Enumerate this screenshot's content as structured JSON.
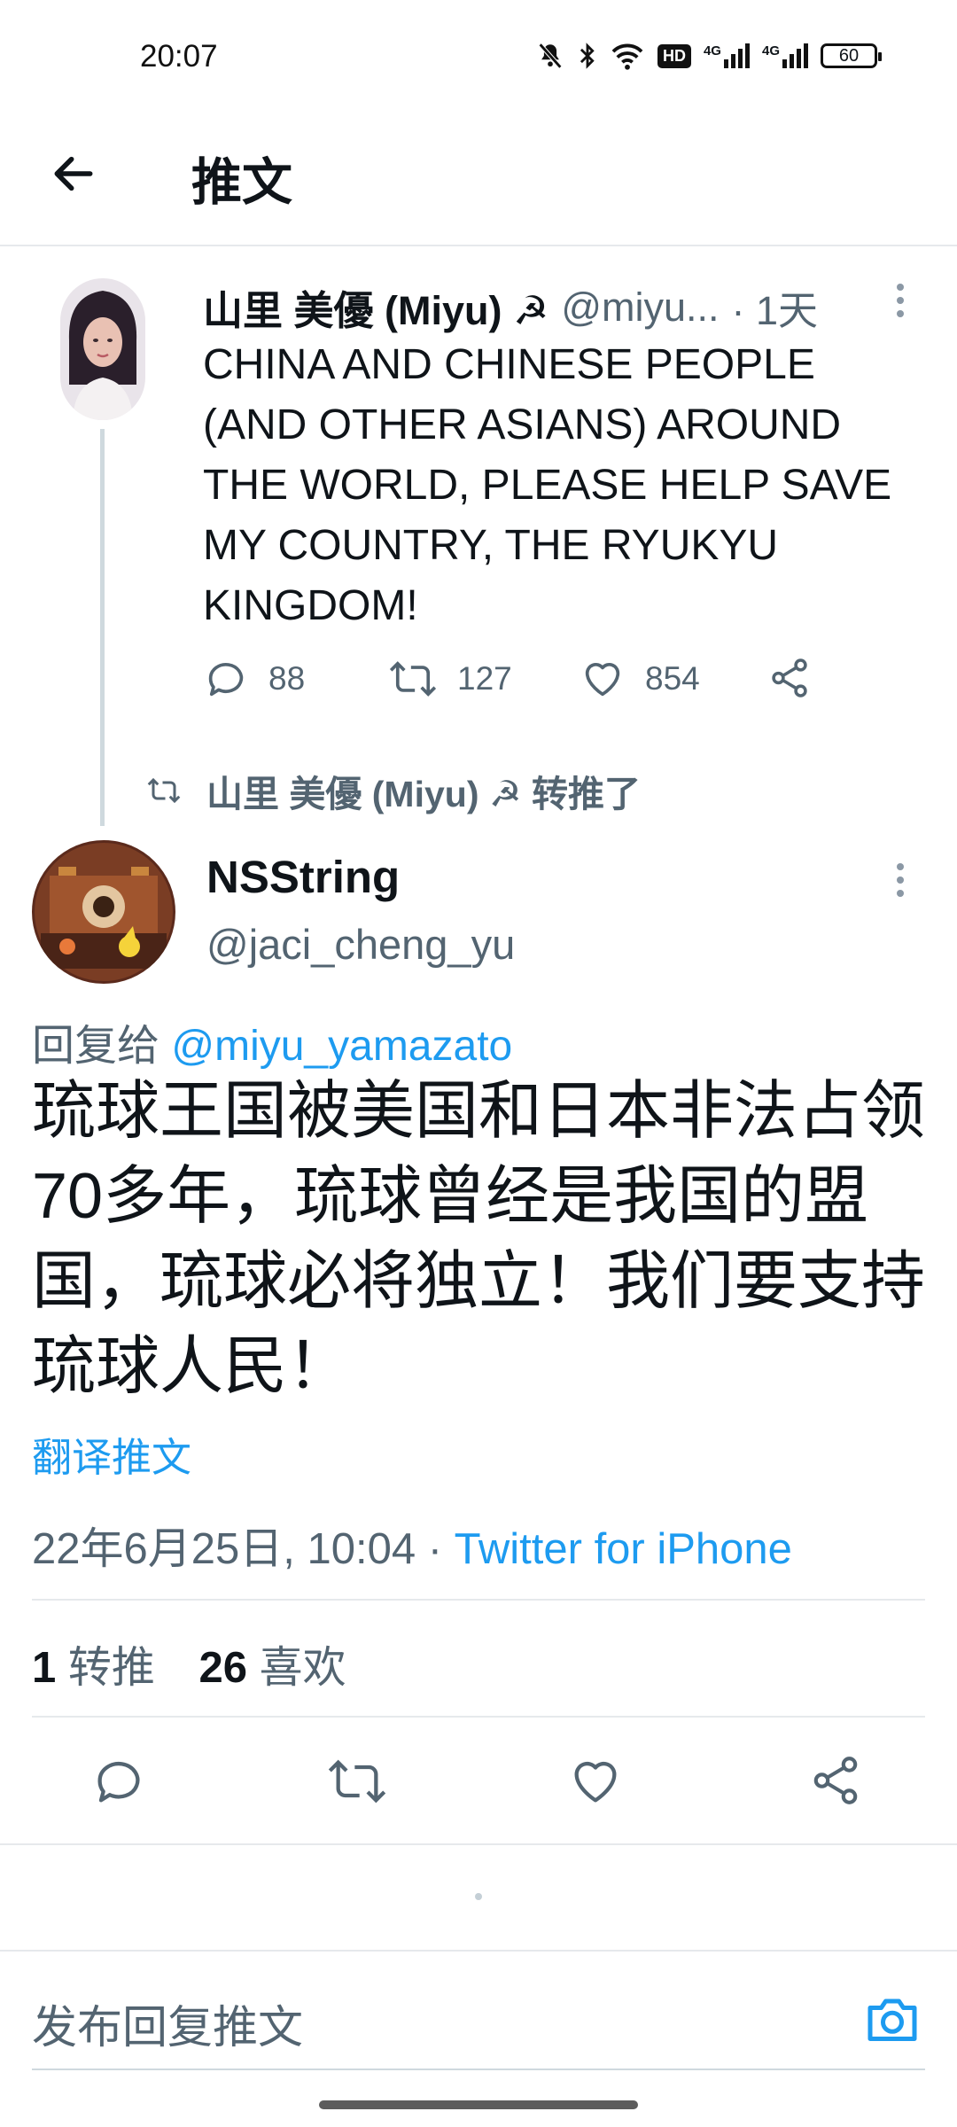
{
  "status_bar": {
    "time": "20:07",
    "hd": "HD",
    "signal1_label": "4G",
    "signal2_label": "4G",
    "battery": "60",
    "icons": [
      "mute-bell-icon",
      "bluetooth-icon",
      "wifi-icon",
      "hd-icon",
      "signal-icon",
      "signal-icon",
      "battery-icon"
    ]
  },
  "header": {
    "title": "推文"
  },
  "parent_tweet": {
    "name": "山里 美優 (Miyu) ☭",
    "handle": "@miyu...",
    "time": "· 1天",
    "text": "CHINA AND CHINESE PEOPLE (AND OTHER ASIANS) AROUND THE WORLD, PLEASE HELP SAVE MY COUNTRY, THE RYUKYU KINGDOM!",
    "replies": "88",
    "retweets": "127",
    "likes": "854"
  },
  "retweet_notice": "山里 美優 (Miyu) ☭ 转推了",
  "main_tweet": {
    "name": "NSString",
    "handle": "@jaci_cheng_yu",
    "reply_prefix": "回复给",
    "reply_mention": "@miyu_yamazato",
    "text": "琉球王国被美国和日本非法占领70多年，琉球曾经是我国的盟国，琉球必将独立！我们要支持琉球人民！",
    "translate": "翻译推文",
    "timestamp": "22年6月25日, 10:04 · ",
    "source": "Twitter for iPhone",
    "retweet_count": "1",
    "retweet_label": "转推",
    "like_count": "26",
    "like_label": "喜欢"
  },
  "composer": {
    "placeholder": "发布回复推文"
  },
  "colors": {
    "accent": "#1d9bf0",
    "muted": "#536471",
    "text": "#0f1419",
    "divider": "#e6e9ec"
  }
}
